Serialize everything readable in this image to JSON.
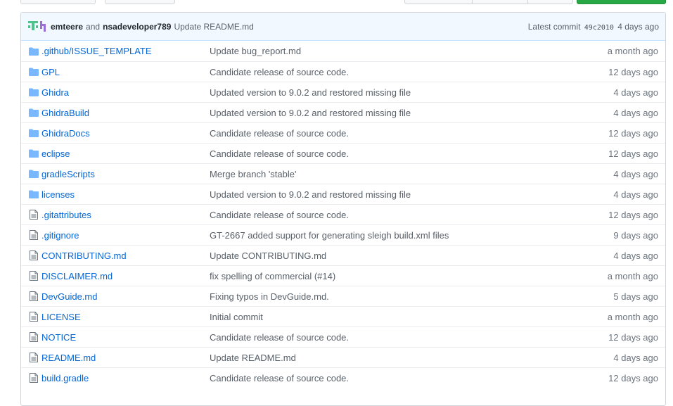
{
  "commit_bar": {
    "author1": "emteere",
    "and_text": "and",
    "author2": "nsadeveloper789",
    "message": "Update README.md",
    "latest_label": "Latest commit",
    "sha": "49c2010",
    "age": "4 days ago"
  },
  "colors": {
    "link": "#0366d6",
    "folder": "#79b8ff",
    "file": "#6a737d",
    "commit_bar_bg": "#f1f8ff",
    "primary_button": "#28a745"
  },
  "files": [
    {
      "name": ".github/ISSUE_TEMPLATE",
      "type": "folder",
      "message": "Update bug_report.md",
      "age": "a month ago"
    },
    {
      "name": "GPL",
      "type": "folder",
      "message": "Candidate release of source code.",
      "age": "12 days ago"
    },
    {
      "name": "Ghidra",
      "type": "folder",
      "message": "Updated version to 9.0.2 and restored missing file",
      "age": "4 days ago"
    },
    {
      "name": "GhidraBuild",
      "type": "folder",
      "message": "Updated version to 9.0.2 and restored missing file",
      "age": "4 days ago"
    },
    {
      "name": "GhidraDocs",
      "type": "folder",
      "message": "Candidate release of source code.",
      "age": "12 days ago"
    },
    {
      "name": "eclipse",
      "type": "folder",
      "message": "Candidate release of source code.",
      "age": "12 days ago"
    },
    {
      "name": "gradleScripts",
      "type": "folder",
      "message": "Merge branch 'stable'",
      "age": "4 days ago"
    },
    {
      "name": "licenses",
      "type": "folder",
      "message": "Updated version to 9.0.2 and restored missing file",
      "age": "4 days ago"
    },
    {
      "name": ".gitattributes",
      "type": "file",
      "message": "Candidate release of source code.",
      "age": "12 days ago"
    },
    {
      "name": ".gitignore",
      "type": "file",
      "message": "GT-2667 added support for generating sleigh build.xml files",
      "age": "9 days ago"
    },
    {
      "name": "CONTRIBUTING.md",
      "type": "file",
      "message": "Update CONTRIBUTING.md",
      "age": "4 days ago"
    },
    {
      "name": "DISCLAIMER.md",
      "type": "file",
      "message": "fix spelling of commercial (#14)",
      "age": "a month ago"
    },
    {
      "name": "DevGuide.md",
      "type": "file",
      "message": "Fixing typos in DevGuide.md.",
      "age": "5 days ago"
    },
    {
      "name": "LICENSE",
      "type": "file",
      "message": "Initial commit",
      "age": "a month ago"
    },
    {
      "name": "NOTICE",
      "type": "file",
      "message": "Candidate release of source code.",
      "age": "12 days ago"
    },
    {
      "name": "README.md",
      "type": "file",
      "message": "Update README.md",
      "age": "4 days ago"
    },
    {
      "name": "build.gradle",
      "type": "file",
      "message": "Candidate release of source code.",
      "age": "12 days ago"
    }
  ]
}
